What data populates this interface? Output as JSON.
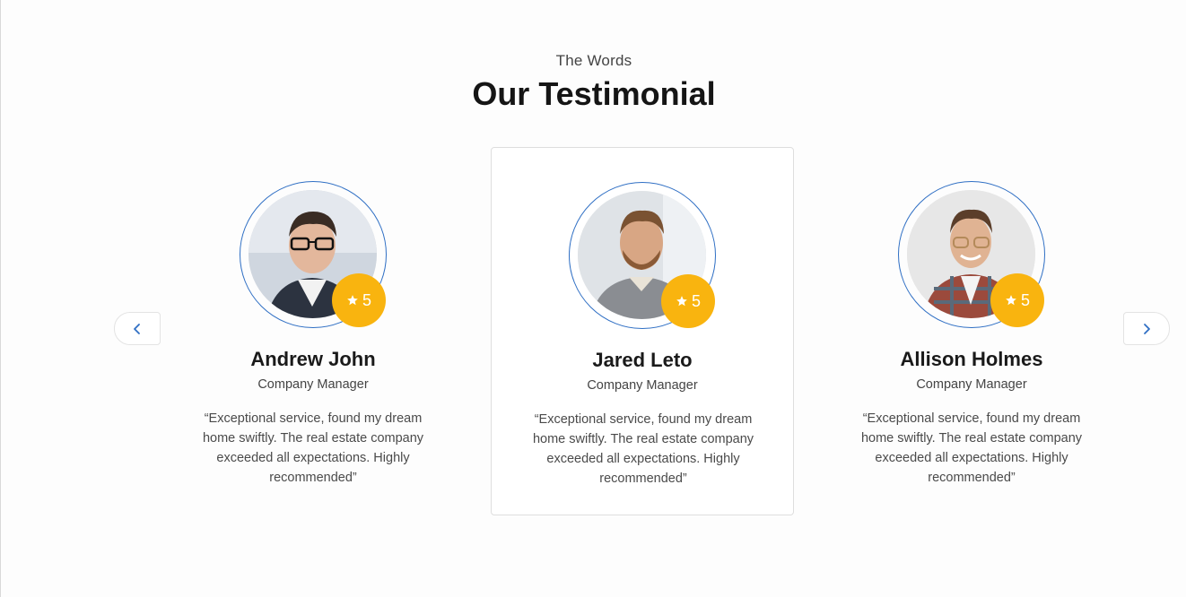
{
  "section": {
    "eyebrow": "The Words",
    "title": "Our Testimonial"
  },
  "nav": {
    "prev_icon": "chevron-left-icon",
    "next_icon": "chevron-right-icon",
    "accent_color": "#2f6fc4"
  },
  "testimonials": [
    {
      "name": "Andrew John",
      "role": "Company Manager",
      "rating": "5",
      "quote": "“Exceptional service, found my dream home swiftly. The real estate company exceeded all expectations. Highly recommended”",
      "active": false
    },
    {
      "name": "Jared Leto",
      "role": "Company Manager",
      "rating": "5",
      "quote": "“Exceptional service, found my dream home swiftly. The real estate company exceeded all expectations. Highly recommended”",
      "active": true
    },
    {
      "name": "Allison Holmes",
      "role": "Company Manager",
      "rating": "5",
      "quote": "“Exceptional service, found my dream home swiftly. The real estate company exceeded all expectations. Highly recommended”",
      "active": false
    }
  ],
  "colors": {
    "rating_badge": "#f9b40f",
    "avatar_ring": "#2f6fc4",
    "title": "#151515",
    "text": "#4a4a4a"
  }
}
